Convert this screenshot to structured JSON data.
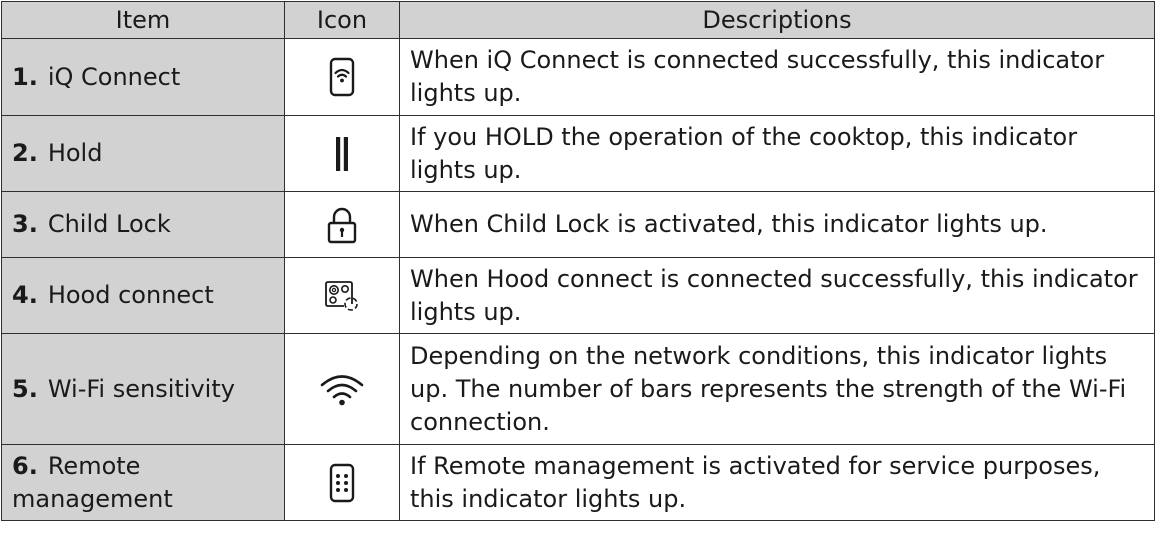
{
  "table": {
    "headers": {
      "item": "Item",
      "icon": "Icon",
      "description": "Descriptions"
    },
    "rows": [
      {
        "number": "1.",
        "item": "iQ Connect",
        "icon": "iq-connect-icon",
        "description": "When iQ Connect is connected successfully, this indicator lights up."
      },
      {
        "number": "2.",
        "item": "Hold",
        "icon": "hold-pause-icon",
        "description": "If you HOLD the operation of the cooktop, this indicator lights up."
      },
      {
        "number": "3.",
        "item": "Child Lock",
        "icon": "child-lock-icon",
        "description": "When Child Lock is activated, this indicator lights up."
      },
      {
        "number": "4.",
        "item": "Hood connect",
        "icon": "hood-connect-icon",
        "description": "When Hood connect is connected successfully, this indicator lights up."
      },
      {
        "number": "5.",
        "item": "Wi-Fi sensitivity",
        "icon": "wifi-signal-icon",
        "description": "Depending on the network conditions, this indicator lights up. The number of bars represents the strength of the Wi-Fi connection."
      },
      {
        "number": "6.",
        "item": "Remote management",
        "icon": "remote-management-icon",
        "description": "If Remote management is activated for service purposes, this indicator lights up."
      }
    ]
  }
}
